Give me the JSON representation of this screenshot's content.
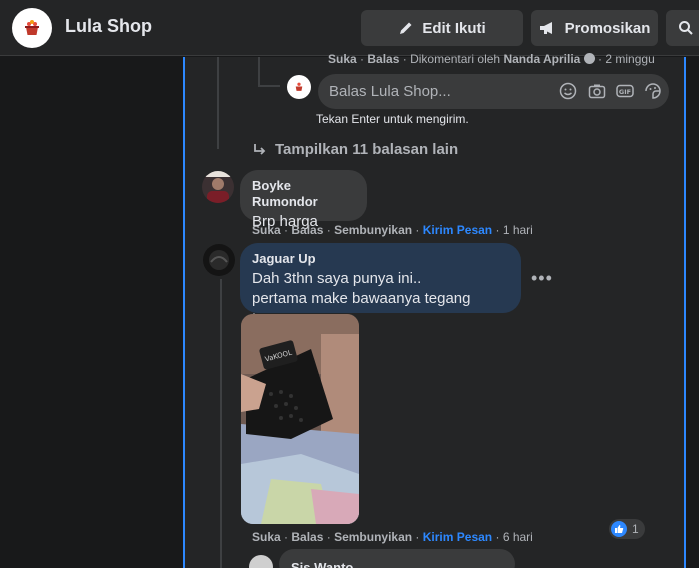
{
  "header": {
    "page_name": "Lula Shop",
    "edit_button": "Edit Ikuti",
    "promote_button": "Promosikan"
  },
  "thread": {
    "prev_meta": {
      "like": "Suka",
      "reply": "Balas",
      "commented_by_prefix": "Dikomentari oleh",
      "commented_by": "Nanda Aprilia",
      "time": "2 minggu"
    },
    "reply_placeholder": "Balas Lula Shop...",
    "reply_hint": "Tekan Enter untuk mengirim.",
    "more_replies": "Tampilkan 11 balasan lain"
  },
  "comments": [
    {
      "author": "Boyke Rumondor",
      "lines": [
        "Brp harga"
      ],
      "actions": {
        "like": "Suka",
        "reply": "Balas",
        "hide": "Sembunyikan",
        "message": "Kirim Pesan",
        "time": "1 hari"
      }
    },
    {
      "author": "Jaguar Up",
      "lines": [
        "Dah 3thn saya punya ini..",
        "pertama make bawaanya tegang terus,"
      ],
      "actions": {
        "like": "Suka",
        "reply": "Balas",
        "hide": "Sembunyikan",
        "message": "Kirim Pesan",
        "time": "6 hari"
      },
      "reaction_count": "1",
      "photo_label": "VaKOOL"
    },
    {
      "author": "Sis Wanto",
      "lines": []
    }
  ],
  "colors": {
    "background": "#18191a",
    "surface": "#242526",
    "bubble": "#3a3b3c",
    "own_bubble": "#263951",
    "accent": "#2d88ff",
    "text_secondary": "#b0b3b8"
  },
  "icons": {
    "edit": "pencil-icon",
    "promote": "megaphone-icon",
    "search": "search-icon",
    "reply_arrow": "reply-arrow-icon",
    "emoji": "emoji-icon",
    "camera": "camera-icon",
    "gif": "gif-icon",
    "sticker": "sticker-icon",
    "more": "more-options-icon",
    "like": "like-icon"
  }
}
